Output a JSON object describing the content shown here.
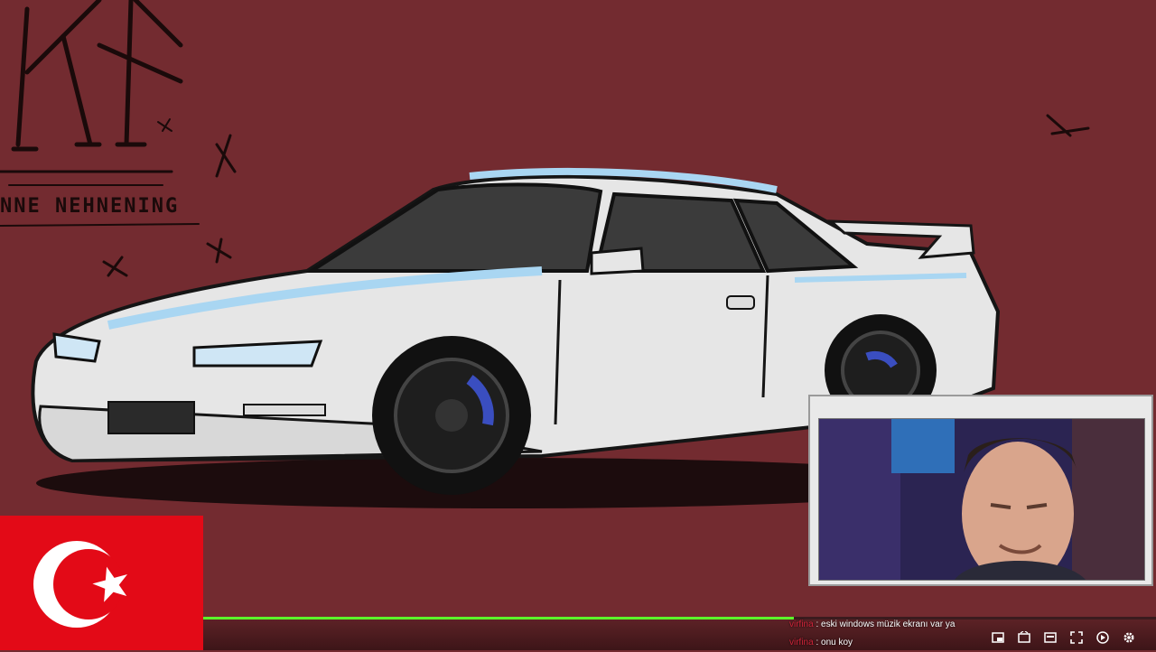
{
  "background": {
    "color": "#732b30",
    "art_caption": "NNE NEHNENING",
    "art_description": "illustrated white sports coupe with tinted windows and rear spoiler"
  },
  "flag": {
    "name": "turkey-flag",
    "color": "#e30a17"
  },
  "webcam": {
    "label": "webcam-overlay"
  },
  "progress": {
    "value_percent": 62,
    "color": "#5cff2a"
  },
  "chat": {
    "messages": [
      {
        "user": "virfina",
        "text": "eski windows müzik ekranı var ya"
      },
      {
        "user": "virfina",
        "text": "onu koy"
      }
    ],
    "separator": " : "
  },
  "controls": [
    {
      "name": "miniplayer-icon"
    },
    {
      "name": "theater-icon"
    },
    {
      "name": "cast-icon"
    },
    {
      "name": "fullscreen-icon"
    },
    {
      "name": "autoplay-icon"
    },
    {
      "name": "settings-icon"
    }
  ]
}
